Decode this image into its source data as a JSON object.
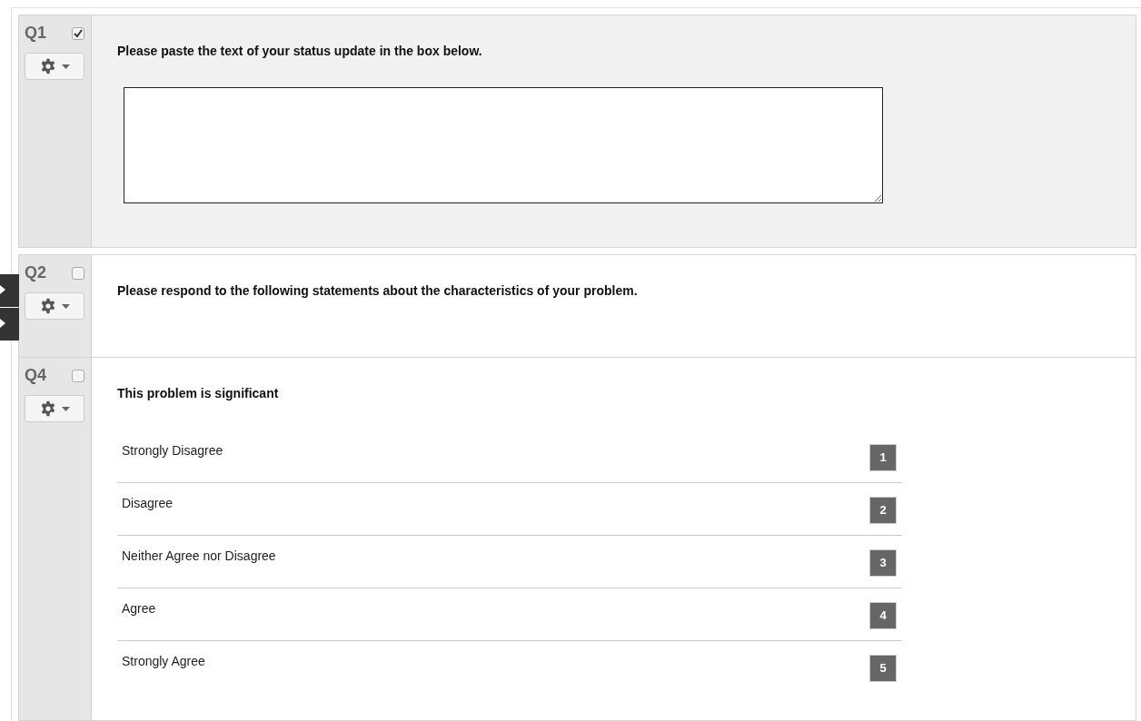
{
  "questions": [
    {
      "number": "Q1",
      "checked": true,
      "kind": "text_entry",
      "prompt": "Please paste the text of your status update in the box below."
    },
    {
      "number": "Q2",
      "checked": false,
      "kind": "description",
      "prompt": "Please respond to the following statements about the characteristics of your problem."
    },
    {
      "number": "Q4",
      "checked": false,
      "kind": "choices",
      "prompt": "This problem is significant",
      "choices": [
        {
          "label": "Strongly Disagree",
          "key": "1"
        },
        {
          "label": "Disagree",
          "key": "2"
        },
        {
          "label": "Neither Agree nor Disagree",
          "key": "3"
        },
        {
          "label": "Agree",
          "key": "4"
        },
        {
          "label": "Strongly Agree",
          "key": "5"
        }
      ]
    }
  ]
}
